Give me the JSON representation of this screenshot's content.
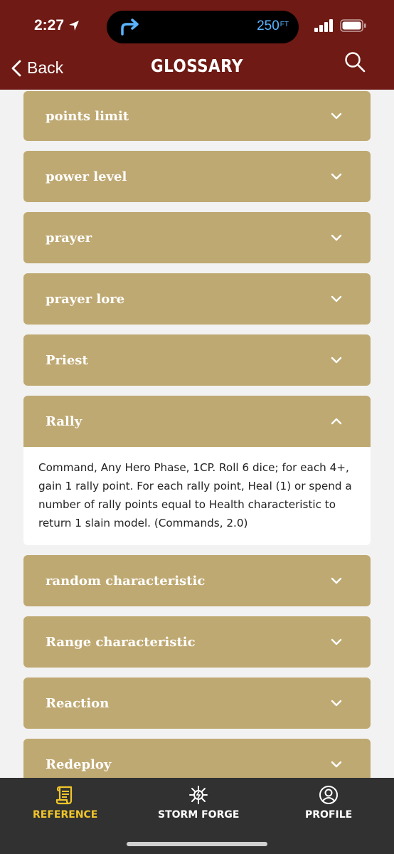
{
  "status": {
    "time": "2:27",
    "distance": "250",
    "distance_unit": "FT"
  },
  "nav": {
    "back_label": "Back",
    "title": "GLOSSARY"
  },
  "items": [
    {
      "label": "points limit"
    },
    {
      "label": "power level"
    },
    {
      "label": "prayer"
    },
    {
      "label": "prayer lore"
    },
    {
      "label": "Priest"
    },
    {
      "label": "Rally",
      "expanded": true,
      "description": "Command, Any Hero Phase, 1CP. Roll 6 dice; for each 4+, gain 1 rally point. For each rally point, Heal (1) or spend a number of rally points equal to Health characteristic to return 1 slain model. (Commands, 2.0)"
    },
    {
      "label": "random characteristic"
    },
    {
      "label": "Range characteristic"
    },
    {
      "label": "Reaction"
    },
    {
      "label": "Redeploy"
    }
  ],
  "tabs": [
    {
      "label": "REFERENCE",
      "active": true
    },
    {
      "label": "STORM FORGE"
    },
    {
      "label": "PROFILE"
    }
  ],
  "colors": {
    "header": "#6f1a14",
    "item": "#bfa972",
    "tabbar": "#313131",
    "active_tab": "#f0c52a"
  }
}
